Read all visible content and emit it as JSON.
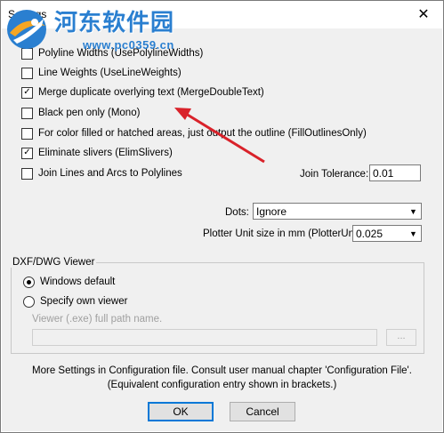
{
  "window": {
    "title": "Settings",
    "close_glyph": "✕"
  },
  "watermark": {
    "title": "河东软件园",
    "url": "www.pc0359.cn"
  },
  "options": [
    {
      "label": "Polyline Widths  (UsePolylineWidths)",
      "checked": false,
      "mark": ""
    },
    {
      "label": "Line Weights  (UseLineWeights)",
      "checked": false,
      "mark": ""
    },
    {
      "label": "Merge duplicate overlying text  (MergeDoubleText)",
      "checked": true,
      "mark": "✓"
    },
    {
      "label": "Black pen only  (Mono)",
      "checked": false,
      "mark": ""
    },
    {
      "label": "For color filled or hatched areas, just output the outline  (FillOutlinesOnly)",
      "checked": false,
      "mark": ""
    },
    {
      "label": "Eliminate slivers  (ElimSlivers)",
      "checked": true,
      "mark": "✓"
    },
    {
      "label": "Join Lines and Arcs to Polylines",
      "checked": false,
      "mark": ""
    }
  ],
  "join_tolerance": {
    "label": "Join Tolerance:",
    "value": "0.01"
  },
  "dots": {
    "label": "Dots:",
    "value": "Ignore"
  },
  "plotter_unit": {
    "label": "Plotter Unit size in mm (PlotterUnit)",
    "value": "0.025"
  },
  "viewer": {
    "group_label": "DXF/DWG Viewer",
    "windows_default": "Windows default",
    "specify_own": "Specify own viewer",
    "path_label": "Viewer (.exe) full path name.",
    "path_value": "",
    "browse_label": "...",
    "selected": "windows_default"
  },
  "info": {
    "line1": "More Settings in Configuration file.  Consult user manual chapter 'Configuration File'.",
    "line2": "(Equivalent configuration entry shown in brackets.)"
  },
  "buttons": {
    "ok": "OK",
    "cancel": "Cancel"
  },
  "icons": {
    "dropdown": "▼"
  },
  "colors": {
    "arrow": "#d9222a",
    "accent": "#0078d7"
  }
}
